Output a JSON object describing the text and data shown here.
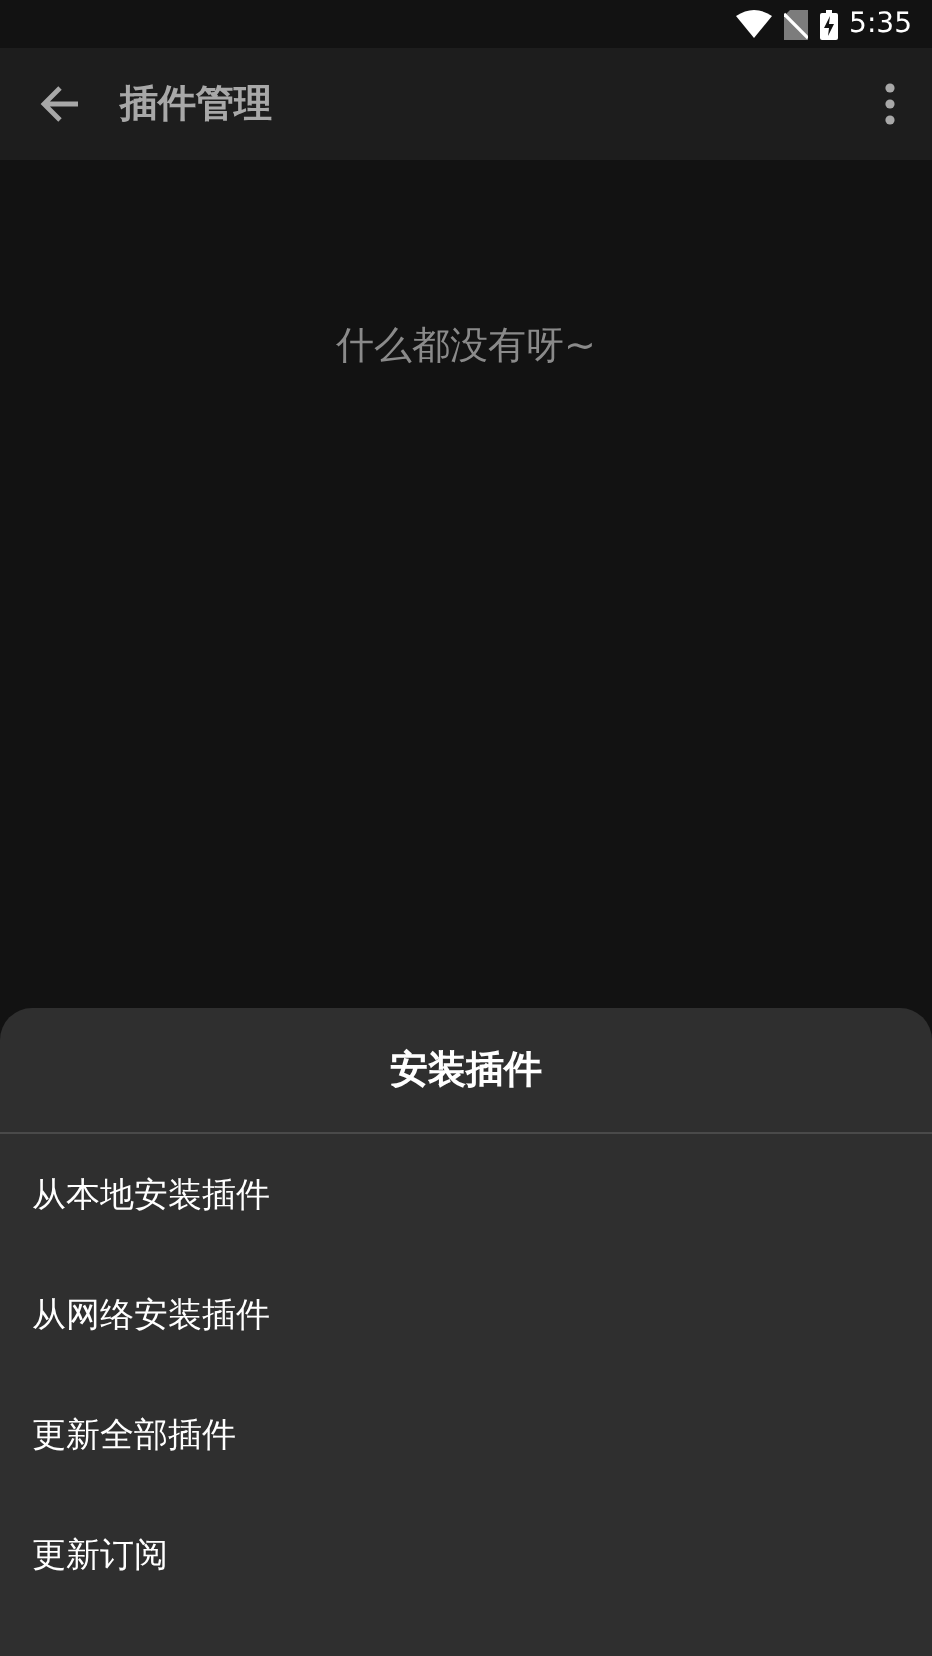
{
  "status_bar": {
    "time": "5:35"
  },
  "app_bar": {
    "title": "插件管理"
  },
  "empty_message": "什么都没有呀~",
  "bottom_sheet": {
    "title": "安装插件",
    "items": [
      {
        "label": "从本地安装插件"
      },
      {
        "label": "从网络安装插件"
      },
      {
        "label": "更新全部插件"
      },
      {
        "label": "更新订阅"
      }
    ]
  }
}
